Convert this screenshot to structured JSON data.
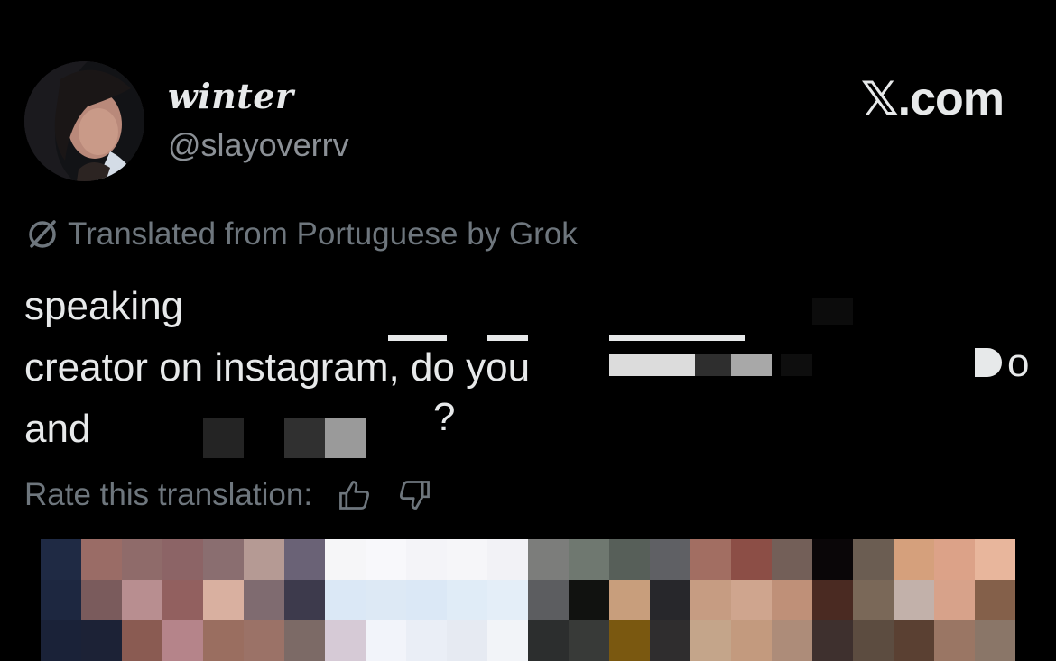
{
  "header": {
    "display_name": "winter",
    "handle": "@slayoverrv",
    "brand": "𝕏.com"
  },
  "translation": {
    "notice": "Translated from Portuguese by Grok",
    "icon": "grok-icon"
  },
  "tweet": {
    "lines": [
      "speaking",
      "creator on instagram, do you think",
      "and"
    ]
  },
  "rating": {
    "label": "Rate this translation:",
    "thumbs_up_icon": "thumbs-up-icon",
    "thumbs_down_icon": "thumbs-down-icon"
  },
  "media": {
    "description": "pixelated-image",
    "colors": [
      "#1f2a44",
      "#9a6c66",
      "#8f6b6a",
      "#8c6466",
      "#8a6e70",
      "#b59a94",
      "#6a6276",
      "#f6f6f8",
      "#f8f8fb",
      "#f4f4f8",
      "#f6f6f9",
      "#f2f2f6",
      "#7c7d7b",
      "#6f7870",
      "#575f59",
      "#5f6064",
      "#a26e62",
      "#8c4e46",
      "#735f58",
      "#0a0608",
      "#6b5d52",
      "#d5a07c",
      "#dca288",
      "#e8b69c",
      "#1d2740",
      "#7a5b5c",
      "#b88e90",
      "#92605f",
      "#d9b0a0",
      "#7f6b70",
      "#3d3a4c",
      "#dbe8f6",
      "#dde9f5",
      "#dbe8f6",
      "#e0ecf7",
      "#e4eef8",
      "#5c5d60",
      "#111210",
      "#c89e7c",
      "#27272b",
      "#c69c82",
      "#cfa58e",
      "#bf9078",
      "#4a2a22",
      "#7a6858",
      "#c2b1aa",
      "#d7a28a",
      "#84604a",
      "#1a2238",
      "#1c2236",
      "#8a5b52",
      "#b5848a",
      "#9a6e60",
      "#9b7267",
      "#7c6a66",
      "#d6cad6",
      "#f2f4fa",
      "#eaeef6",
      "#e6eaf2",
      "#f2f4f8",
      "#2c2e2e",
      "#383a38",
      "#7a5810",
      "#2f2d2e",
      "#c4a58a",
      "#c39a7e",
      "#ad8c79",
      "#3e302e",
      "#5c4c40",
      "#5a4032",
      "#9a7664",
      "#8a7668"
    ]
  }
}
